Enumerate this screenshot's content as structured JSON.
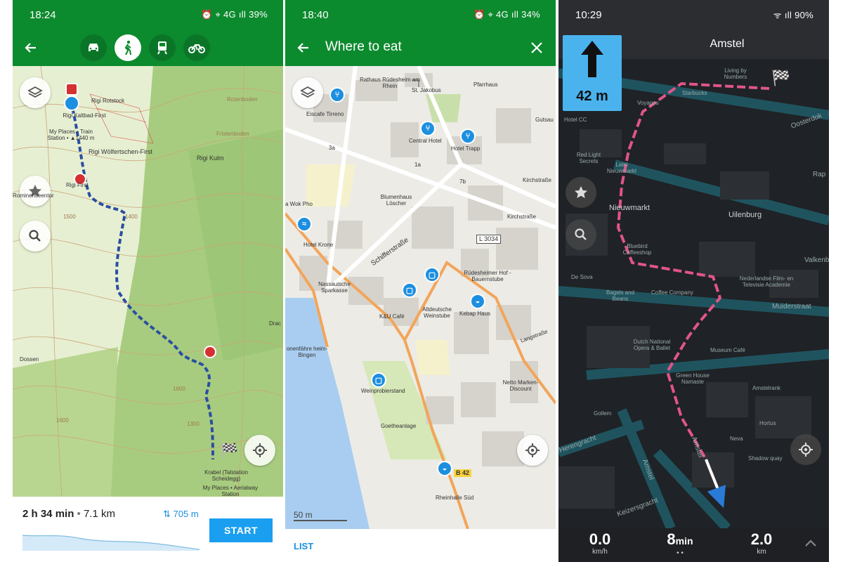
{
  "screen1": {
    "status": {
      "time": "18:24",
      "right": "⏰ ⌖ 4G ıll 39%"
    },
    "travel_modes": [
      "car",
      "walk",
      "train",
      "bike"
    ],
    "map_labels": [
      "Rigi Rotstock",
      "Rigi Kaltbad-First",
      "My Places • Train Station • ▲1440 m",
      "Rigi Wölfertschen-First",
      "Rigi Kulm",
      "Rigi First",
      "Rominenseentor",
      "Rotenboden",
      "Fristenboden",
      "Dossen",
      "Krabel (Talstation Scheidegg)",
      "My Places • Aerialway Station",
      "Drac",
      "1500",
      "1400",
      "1600",
      "1600",
      "1300"
    ],
    "summary": {
      "time": "2 h 34 min",
      "separator": "•",
      "distance": "7.1 km",
      "ascent": "705 m"
    },
    "start_label": "START"
  },
  "screen2": {
    "status": {
      "time": "18:40",
      "right": "⏰ ⌖ 4G ıll 34%"
    },
    "title": "Where to eat",
    "map_labels": [
      "Rathaus Rüdesheim am Rhein",
      "St. Jakobus",
      "Pfarrhaus",
      "Eiscafe Tirreno",
      "Central Hotel",
      "Hotel Trapp",
      "Blumenhaus Löscher",
      "Kirchstraße",
      "Kirchstraße",
      "a Wok Pho",
      "Hotel Krone",
      "Schifferstraße",
      "L 3034",
      "Rüdesheimer Hof - Bauernstube",
      "Nassauische Sparkasse",
      "Altdeutsche Weinstube",
      "K&U Café",
      "Kebap Haus",
      "Langstraße",
      "Weinprobierstand",
      "Netto Marken-Discount",
      "Goetheanlage",
      "Rheinhalle Süd",
      "B 42",
      "onenfähre heim-Bingen",
      "Gutsau",
      "3a",
      "7b",
      "1a"
    ],
    "scale": "50 m",
    "list_label": "LIST"
  },
  "screen3": {
    "status": {
      "time": "10:29",
      "right": "ᯤ ıll 90%"
    },
    "street": "Amstel",
    "turn_distance": "42 m",
    "map_labels": [
      "Living by Numbers",
      "Starbucks",
      "Voyages",
      "Hotel CC",
      "Red Light Secrets",
      "Latei Nieuwmarkt",
      "Nieuwmarkt",
      "Uilenburg",
      "Bluebird Coffeeshop",
      "De Sova",
      "Bagels and Beans",
      "Coffee Company",
      "Nederlandse Film- en Televisie Academie",
      "Muiderstraat",
      "Dutch National Opera & Ballet",
      "Museum Café",
      "Green House Namaste",
      "Amstelrank",
      "Gollem",
      "Neva",
      "Hortus",
      "Shadow quay",
      "Herengracht",
      "Amstel",
      "Keizersgracht",
      "Oosterdok",
      "Valkenb",
      "Rap",
      "Amstel"
    ],
    "speed": {
      "value": "0.0",
      "unit": "km/h"
    },
    "eta": {
      "value": "8",
      "unit": "min"
    },
    "remaining": {
      "value": "2.0",
      "unit": "km"
    }
  }
}
